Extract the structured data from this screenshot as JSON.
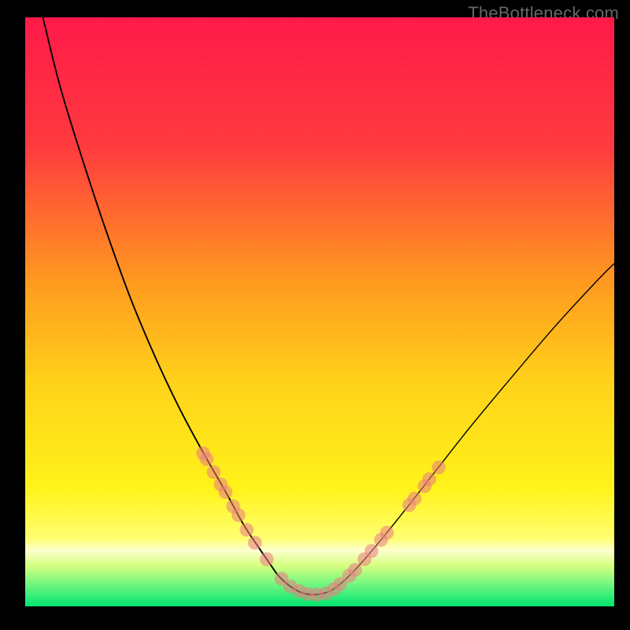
{
  "watermark": "TheBottleneck.com",
  "colors": {
    "gradient_stops": [
      {
        "offset": 0.0,
        "color": "#ff1a49"
      },
      {
        "offset": 0.22,
        "color": "#ff3b3f"
      },
      {
        "offset": 0.45,
        "color": "#ff9a1f"
      },
      {
        "offset": 0.62,
        "color": "#ffd21a"
      },
      {
        "offset": 0.8,
        "color": "#fff31a"
      },
      {
        "offset": 0.885,
        "color": "#ffff70"
      },
      {
        "offset": 0.905,
        "color": "#fdffd0"
      },
      {
        "offset": 0.93,
        "color": "#d8ff80"
      },
      {
        "offset": 0.96,
        "color": "#79f780"
      },
      {
        "offset": 1.0,
        "color": "#00e571"
      }
    ],
    "curve": "#000000",
    "marker": "#e97f80"
  },
  "chart_data": {
    "type": "line",
    "title": "",
    "xlabel": "",
    "ylabel": "",
    "xlim": [
      0,
      100
    ],
    "ylim": [
      0,
      100
    ],
    "series": [
      {
        "name": "curve",
        "x": [
          3,
          6,
          10,
          14,
          18,
          22,
          26,
          30,
          34,
          37,
          39.5,
          41.5,
          43,
          45,
          47,
          49,
          51,
          53,
          56,
          60,
          65,
          70,
          76,
          83,
          90,
          97,
          100
        ],
        "y": [
          100,
          88,
          75,
          63,
          52,
          42.5,
          34,
          26.5,
          19.5,
          14,
          10.2,
          7.3,
          5.2,
          3.4,
          2.3,
          2.0,
          2.3,
          3.4,
          6.2,
          10.8,
          17.0,
          23.4,
          31.0,
          39.4,
          47.6,
          55.2,
          58.2
        ]
      }
    ],
    "markers_left": [
      {
        "x": 30.2,
        "y": 26.0
      },
      {
        "x": 30.8,
        "y": 25.0
      },
      {
        "x": 32.0,
        "y": 22.8
      },
      {
        "x": 33.2,
        "y": 20.7
      },
      {
        "x": 34.0,
        "y": 19.4
      },
      {
        "x": 35.3,
        "y": 17.0
      },
      {
        "x": 36.2,
        "y": 15.5
      },
      {
        "x": 37.6,
        "y": 13.0
      },
      {
        "x": 39.0,
        "y": 10.8
      },
      {
        "x": 41.0,
        "y": 8.0
      }
    ],
    "markers_bottom": [
      {
        "x": 43.5,
        "y": 4.7
      },
      {
        "x": 45.0,
        "y": 3.4
      },
      {
        "x": 46.5,
        "y": 2.6
      },
      {
        "x": 48.0,
        "y": 2.1
      },
      {
        "x": 49.5,
        "y": 2.0
      },
      {
        "x": 51.0,
        "y": 2.2
      },
      {
        "x": 52.4,
        "y": 2.9
      },
      {
        "x": 53.5,
        "y": 3.8
      },
      {
        "x": 55.0,
        "y": 5.2
      }
    ],
    "markers_right": [
      {
        "x": 56.0,
        "y": 6.2
      },
      {
        "x": 57.6,
        "y": 8.0
      },
      {
        "x": 58.8,
        "y": 9.4
      },
      {
        "x": 60.4,
        "y": 11.3
      },
      {
        "x": 61.4,
        "y": 12.5
      },
      {
        "x": 65.2,
        "y": 17.2
      },
      {
        "x": 66.1,
        "y": 18.3
      },
      {
        "x": 67.8,
        "y": 20.4
      },
      {
        "x": 68.6,
        "y": 21.6
      },
      {
        "x": 70.2,
        "y": 23.6
      }
    ]
  }
}
